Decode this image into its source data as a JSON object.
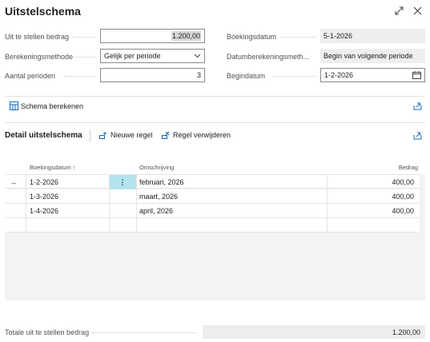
{
  "window": {
    "title": "Uitstelschema"
  },
  "fields": {
    "amount_label": "Uit te stellen bedrag",
    "amount_value": "1.200,00",
    "method_label": "Berekeningsmethode",
    "method_value": "Gelijk per periode",
    "periods_label": "Aantal perioden",
    "periods_value": "3",
    "posting_date_label": "Boekingsdatum",
    "posting_date_value": "5-1-2026",
    "calc_method_label": "Datumberekeningsmeth...",
    "calc_method_value": "Begin van volgende periode",
    "start_date_label": "Begindatum",
    "start_date_value": "1-2-2026"
  },
  "actions": {
    "calculate_label": "Schema berekenen"
  },
  "detail": {
    "title": "Detail uitstelschema",
    "new_line_label": "Nieuwe regel",
    "delete_line_label": "Regel verwijderen",
    "columns": {
      "date": "Boekingsdatum ↑",
      "description": "Omschrijving",
      "amount": "Bedrag"
    },
    "rows": [
      {
        "date": "1-2-2026",
        "description": "februari, 2026",
        "amount": "400,00"
      },
      {
        "date": "1-3-2026",
        "description": "maart, 2026",
        "amount": "400,00"
      },
      {
        "date": "1-4-2026",
        "description": "april, 2026",
        "amount": "400,00"
      }
    ]
  },
  "footer": {
    "total_label": "Totale uit te stellen bedrag",
    "total_value": "1.200,00"
  },
  "colors": {
    "accent": "#0f6cbd",
    "selected_cell": "#b3e5ef"
  }
}
